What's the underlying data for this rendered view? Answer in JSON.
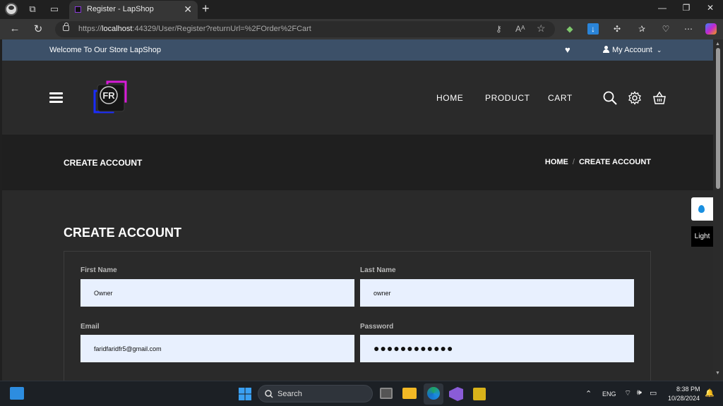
{
  "browser": {
    "tab_title": "Register - LapShop",
    "url_prefix": "https://",
    "url_host": "localhost",
    "url_rest": ":44329/User/Register?returnUrl=%2FOrder%2FCart",
    "tab_close": "✕",
    "new_tab": "+",
    "reader_label": "Aᴬ"
  },
  "site": {
    "welcome": "Welcome To Our Store LapShop",
    "account_label": "My Account",
    "logo_text": "FR",
    "nav": [
      "HOME",
      "PRODUCT",
      "CART"
    ],
    "banner_title": "CREATE ACCOUNT",
    "breadcrumb": {
      "home": "HOME",
      "separator": "/",
      "current": "CREATE ACCOUNT"
    },
    "heading": "CREATE ACCOUNT",
    "side_light": "Light"
  },
  "form": {
    "first_name_label": "First Name",
    "first_name_value": "Owner",
    "last_name_label": "Last Name",
    "last_name_value": "owner",
    "email_label": "Email",
    "email_value": "faridfaridfr5@gmail.com",
    "password_label": "Password",
    "password_mask": "●●●●●●●●●●●●"
  },
  "taskbar": {
    "search_label": "Search",
    "lang": "ENG",
    "time": "8:38 PM",
    "date": "10/28/2024"
  },
  "colors": {
    "topbar": "#3c5068",
    "input_bg": "#e8f0fe",
    "page_bg": "#2a2a2a",
    "banner_bg": "#1f1f1f"
  }
}
